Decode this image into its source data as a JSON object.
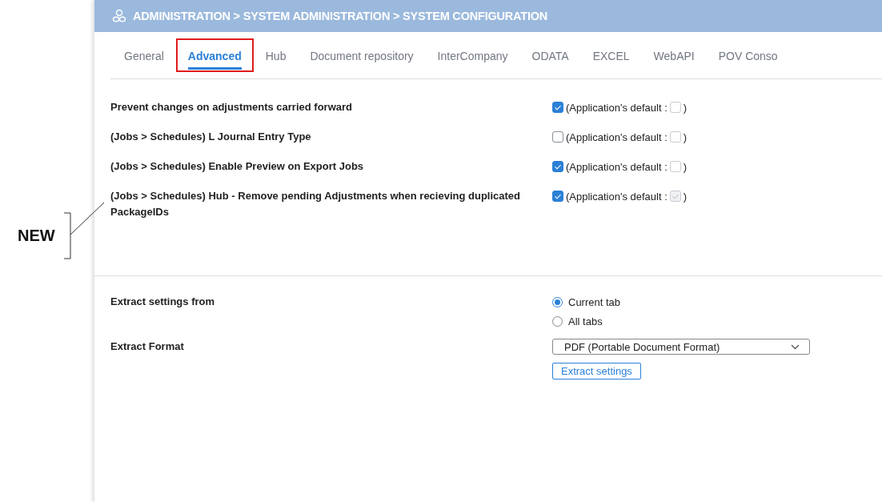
{
  "header": {
    "breadcrumb": "ADMINISTRATION > SYSTEM ADMINISTRATION > SYSTEM CONFIGURATION"
  },
  "tabs": [
    {
      "label": "General",
      "selected": false,
      "highlighted": false
    },
    {
      "label": "Advanced",
      "selected": true,
      "highlighted": true
    },
    {
      "label": "Hub",
      "selected": false,
      "highlighted": false
    },
    {
      "label": "Document repository",
      "selected": false,
      "highlighted": false
    },
    {
      "label": "InterCompany",
      "selected": false,
      "highlighted": false
    },
    {
      "label": "ODATA",
      "selected": false,
      "highlighted": false
    },
    {
      "label": "EXCEL",
      "selected": false,
      "highlighted": false
    },
    {
      "label": "WebAPI",
      "selected": false,
      "highlighted": false
    },
    {
      "label": "POV Conso",
      "selected": false,
      "highlighted": false
    }
  ],
  "settings": [
    {
      "label": "Prevent changes on adjustments carried forward",
      "checked": true,
      "default_prefix": "(Application's default :",
      "default_checked": false,
      "default_suffix": ")"
    },
    {
      "label": "(Jobs > Schedules) L Journal Entry Type",
      "checked": false,
      "default_prefix": "(Application's default :",
      "default_checked": false,
      "default_suffix": ")"
    },
    {
      "label": "(Jobs > Schedules) Enable Preview on Export Jobs",
      "checked": true,
      "default_prefix": "(Application's default :",
      "default_checked": false,
      "default_suffix": ")"
    },
    {
      "label": "(Jobs > Schedules) Hub - Remove pending Adjustments when recieving duplicated PackageIDs",
      "checked": true,
      "default_prefix": "(Application's default :",
      "default_checked": true,
      "default_suffix": ")"
    }
  ],
  "extract": {
    "source_label": "Extract settings from",
    "source_options": [
      {
        "label": "Current tab",
        "selected": true
      },
      {
        "label": "All tabs",
        "selected": false
      }
    ],
    "format_label": "Extract Format",
    "format_value": "PDF (Portable Document Format)",
    "button": "Extract settings"
  },
  "annotation": {
    "label": "NEW"
  }
}
